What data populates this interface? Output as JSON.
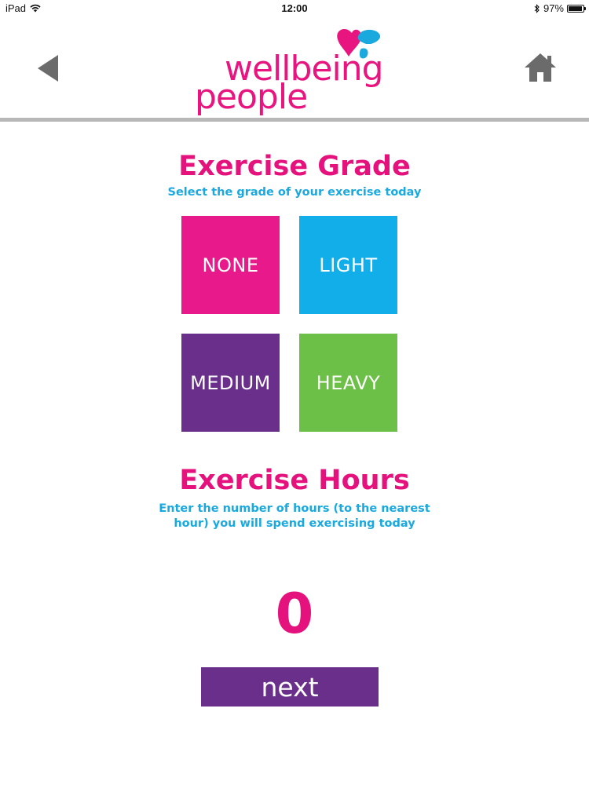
{
  "status_bar": {
    "device": "iPad",
    "time": "12:00",
    "battery": "97%",
    "battery_level": 0.97
  },
  "header": {
    "logo_line1": "wellbeing",
    "logo_line2": "people",
    "back_icon": "back-arrow-icon",
    "home_icon": "home-icon"
  },
  "grade": {
    "title": "Exercise Grade",
    "subtitle": "Select the grade of your exercise today",
    "options": [
      {
        "label": "NONE",
        "color": "#e8198b"
      },
      {
        "label": "LIGHT",
        "color": "#12aeea"
      },
      {
        "label": "MEDIUM",
        "color": "#6a2f8a"
      },
      {
        "label": "HEAVY",
        "color": "#6cbf47"
      }
    ]
  },
  "hours": {
    "title": "Exercise Hours",
    "subtitle_line1": "Enter the number of hours (to the nearest",
    "subtitle_line2": "hour) you will spend exercising today",
    "value": "0"
  },
  "next_label": "next",
  "colors": {
    "pink": "#e5127d",
    "blue": "#1aa9df",
    "purple": "#6a2f8a",
    "green": "#6cbf47"
  }
}
